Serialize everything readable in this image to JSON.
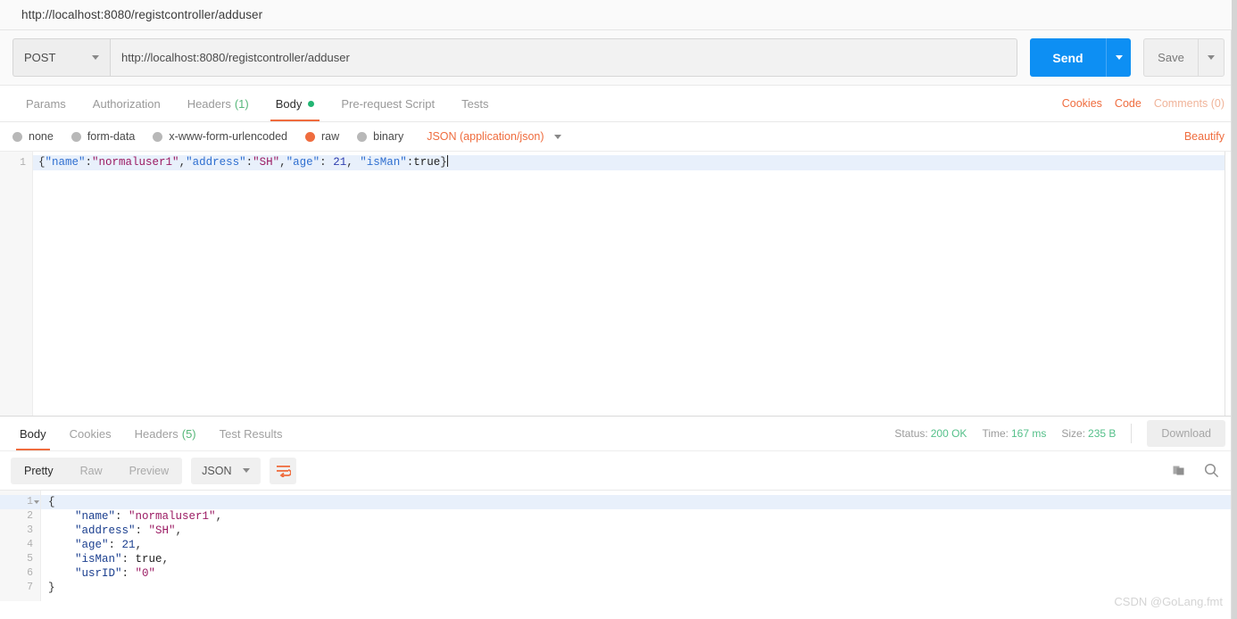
{
  "tab": {
    "name": "http://localhost:8080/registcontroller/adduser"
  },
  "request": {
    "method": "POST",
    "url": "http://localhost:8080/registcontroller/adduser",
    "send_label": "Send",
    "save_label": "Save",
    "tabs": [
      {
        "label": "Params",
        "active": false
      },
      {
        "label": "Authorization",
        "active": false
      },
      {
        "label": "Headers",
        "count": "(1)",
        "active": false
      },
      {
        "label": "Body",
        "active": true,
        "dot": true
      },
      {
        "label": "Pre-request Script",
        "active": false
      },
      {
        "label": "Tests",
        "active": false
      }
    ],
    "links": [
      {
        "label": "Cookies",
        "dim": false
      },
      {
        "label": "Code",
        "dim": false
      },
      {
        "label": "Comments (0)",
        "dim": true
      }
    ],
    "body_types": [
      {
        "label": "none",
        "selected": false
      },
      {
        "label": "form-data",
        "selected": false
      },
      {
        "label": "x-www-form-urlencoded",
        "selected": false
      },
      {
        "label": "raw",
        "selected": true
      },
      {
        "label": "binary",
        "selected": false
      }
    ],
    "content_type": "JSON (application/json)",
    "beautify_label": "Beautify",
    "editor": {
      "line_number": "1",
      "raw": "{\"name\":\"normaluser1\",\"address\":\"SH\",\"age\": 21, \"isMan\":true}",
      "tokens": [
        {
          "t": "{",
          "c": "tk-punc"
        },
        {
          "t": "\"name\"",
          "c": "tk-key"
        },
        {
          "t": ":",
          "c": "tk-punc"
        },
        {
          "t": "\"normaluser1\"",
          "c": "tk-str"
        },
        {
          "t": ",",
          "c": "tk-punc"
        },
        {
          "t": "\"address\"",
          "c": "tk-key"
        },
        {
          "t": ":",
          "c": "tk-punc"
        },
        {
          "t": "\"SH\"",
          "c": "tk-str"
        },
        {
          "t": ",",
          "c": "tk-punc"
        },
        {
          "t": "\"age\"",
          "c": "tk-key"
        },
        {
          "t": ": ",
          "c": "tk-punc"
        },
        {
          "t": "21",
          "c": "tk-num"
        },
        {
          "t": ", ",
          "c": "tk-punc"
        },
        {
          "t": "\"isMan\"",
          "c": "tk-key"
        },
        {
          "t": ":",
          "c": "tk-punc"
        },
        {
          "t": "true",
          "c": "tk-bool"
        },
        {
          "t": "}",
          "c": "tk-punc"
        }
      ]
    }
  },
  "response": {
    "tabs": [
      {
        "label": "Body",
        "active": true
      },
      {
        "label": "Cookies",
        "active": false
      },
      {
        "label": "Headers",
        "count": "(5)",
        "active": false
      },
      {
        "label": "Test Results",
        "active": false
      }
    ],
    "status_label": "Status:",
    "status_value": "200 OK",
    "time_label": "Time:",
    "time_value": "167 ms",
    "size_label": "Size:",
    "size_value": "235 B",
    "download_label": "Download",
    "view_modes": [
      {
        "label": "Pretty",
        "active": true
      },
      {
        "label": "Raw",
        "active": false
      },
      {
        "label": "Preview",
        "active": false
      }
    ],
    "format": "JSON",
    "body_lines": [
      {
        "n": "1",
        "fold": true,
        "tokens": [
          {
            "t": "{",
            "c": "rp"
          }
        ]
      },
      {
        "n": "2",
        "tokens": [
          {
            "t": "    ",
            "c": "rp"
          },
          {
            "t": "\"name\"",
            "c": "rk"
          },
          {
            "t": ": ",
            "c": "rp"
          },
          {
            "t": "\"normaluser1\"",
            "c": "rs"
          },
          {
            "t": ",",
            "c": "rp"
          }
        ]
      },
      {
        "n": "3",
        "tokens": [
          {
            "t": "    ",
            "c": "rp"
          },
          {
            "t": "\"address\"",
            "c": "rk"
          },
          {
            "t": ": ",
            "c": "rp"
          },
          {
            "t": "\"SH\"",
            "c": "rs"
          },
          {
            "t": ",",
            "c": "rp"
          }
        ]
      },
      {
        "n": "4",
        "tokens": [
          {
            "t": "    ",
            "c": "rp"
          },
          {
            "t": "\"age\"",
            "c": "rk"
          },
          {
            "t": ": ",
            "c": "rp"
          },
          {
            "t": "21",
            "c": "rn"
          },
          {
            "t": ",",
            "c": "rp"
          }
        ]
      },
      {
        "n": "5",
        "tokens": [
          {
            "t": "    ",
            "c": "rp"
          },
          {
            "t": "\"isMan\"",
            "c": "rk"
          },
          {
            "t": ": ",
            "c": "rp"
          },
          {
            "t": "true",
            "c": "rb"
          },
          {
            "t": ",",
            "c": "rp"
          }
        ]
      },
      {
        "n": "6",
        "tokens": [
          {
            "t": "    ",
            "c": "rp"
          },
          {
            "t": "\"usrID\"",
            "c": "rk"
          },
          {
            "t": ": ",
            "c": "rp"
          },
          {
            "t": "\"0\"",
            "c": "rs"
          }
        ]
      },
      {
        "n": "7",
        "tokens": [
          {
            "t": "}",
            "c": "rp"
          }
        ]
      }
    ]
  },
  "watermark": "CSDN @GoLang.fmt",
  "colors": {
    "accent_orange": "#ef6c3e",
    "send_blue": "#0d8ff3",
    "status_green": "#55c08a",
    "json_key": "#1b3f8f",
    "json_string": "#9b1b63"
  }
}
